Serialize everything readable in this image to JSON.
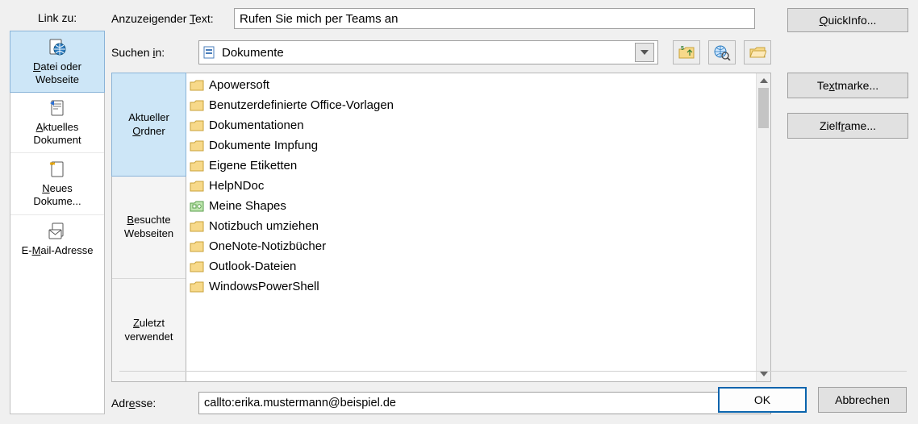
{
  "linkto": {
    "label": "Link zu:",
    "items": [
      {
        "id": "file-or-web",
        "line1_pre": "",
        "acc": "D",
        "line1_post": "atei oder",
        "line2": "Webseite"
      },
      {
        "id": "current-doc",
        "line1_pre": "",
        "acc": "A",
        "line1_post": "ktuelles",
        "line2": "Dokument"
      },
      {
        "id": "new-doc",
        "line1_pre": "",
        "acc": "N",
        "line1_post": "eues",
        "line2": "Dokume..."
      },
      {
        "id": "email",
        "line1_pre": "E-",
        "acc": "M",
        "line1_post": "ail-Adresse",
        "line2": ""
      }
    ],
    "selected": 0
  },
  "display_text": {
    "label_pre": "Anzuzeigender ",
    "label_acc": "T",
    "label_post": "ext:",
    "value": "Rufen Sie mich per Teams an"
  },
  "quickinfo_pre": "",
  "quickinfo_acc": "Q",
  "quickinfo_post": "uickInfo...",
  "suchenin": {
    "label_pre": "Suchen ",
    "label_acc": "i",
    "label_post": "n:",
    "value": "Dokumente"
  },
  "tabs": [
    {
      "line1": "Aktueller",
      "line2_pre": "",
      "line2_acc": "O",
      "line2_post": "rdner"
    },
    {
      "line1_pre": "",
      "line1_acc": "B",
      "line1_post": "esuchte",
      "line2": "Webseiten"
    },
    {
      "line1_pre": "",
      "line1_acc": "Z",
      "line1_post": "uletzt",
      "line2": "verwendet"
    }
  ],
  "tab_selected": 0,
  "files": [
    {
      "name": "Apowersoft",
      "type": "folder"
    },
    {
      "name": "Benutzerdefinierte Office-Vorlagen",
      "type": "folder"
    },
    {
      "name": "Dokumentationen",
      "type": "folder"
    },
    {
      "name": "Dokumente Impfung",
      "type": "folder"
    },
    {
      "name": "Eigene Etiketten",
      "type": "folder"
    },
    {
      "name": "HelpNDoc",
      "type": "folder"
    },
    {
      "name": "Meine Shapes",
      "type": "shapes"
    },
    {
      "name": "Notizbuch umziehen",
      "type": "folder"
    },
    {
      "name": "OneNote-Notizbücher",
      "type": "folder"
    },
    {
      "name": "Outlook-Dateien",
      "type": "folder"
    },
    {
      "name": "WindowsPowerShell",
      "type": "folder"
    }
  ],
  "adresse": {
    "label_pre": "Adr",
    "label_acc": "e",
    "label_post": "sse:",
    "value": "callto:erika.mustermann@beispiel.de"
  },
  "textmarke_pre": "Te",
  "textmarke_acc": "x",
  "textmarke_post": "tmarke...",
  "zielframe_pre": "Zielf",
  "zielframe_acc": "r",
  "zielframe_post": "ame...",
  "buttons": {
    "ok": "OK",
    "cancel": "Abbrechen"
  }
}
